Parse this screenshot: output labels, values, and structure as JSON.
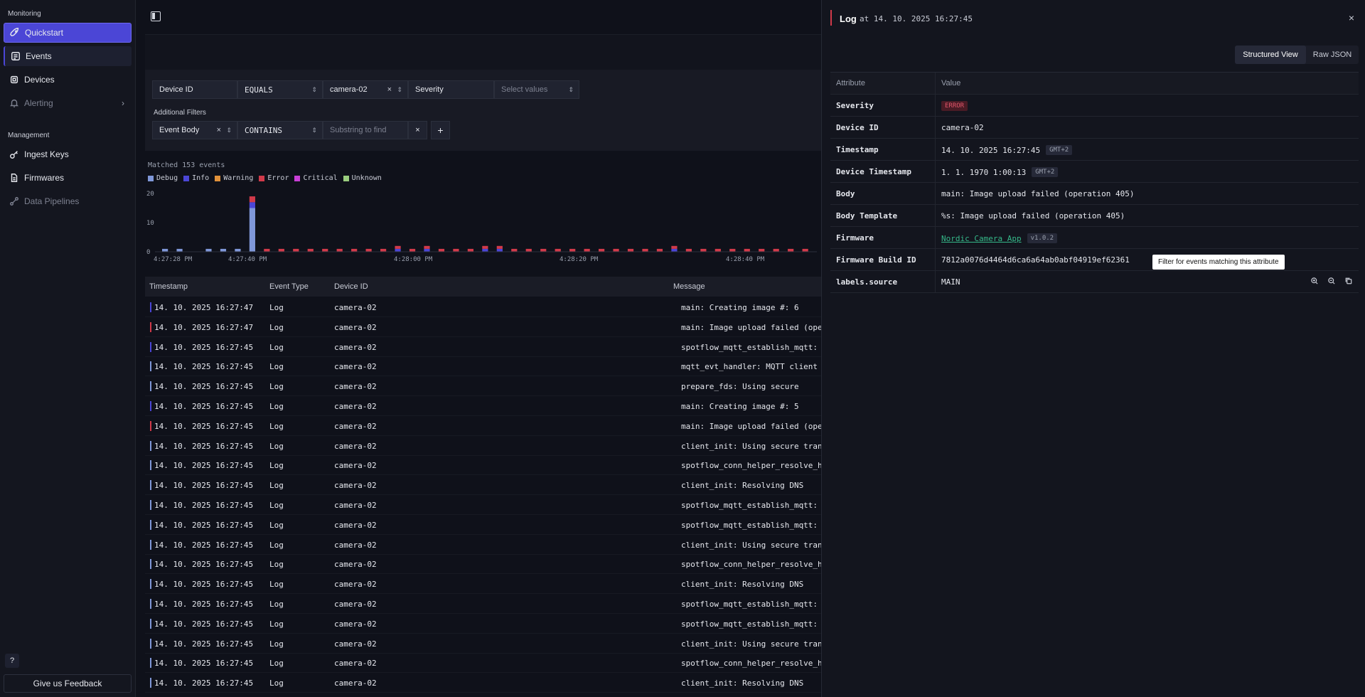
{
  "sidebar": {
    "monitoring_label": "Monitoring",
    "management_label": "Management",
    "items": [
      {
        "label": "Quickstart"
      },
      {
        "label": "Events"
      },
      {
        "label": "Devices"
      },
      {
        "label": "Alerting"
      },
      {
        "label": "Ingest Keys"
      },
      {
        "label": "Firmwares"
      },
      {
        "label": "Data Pipelines"
      }
    ],
    "help": "?",
    "feedback": "Give us Feedback"
  },
  "filters": {
    "field1": "Device ID",
    "op1": "EQUALS",
    "value1": "camera-02",
    "field2": "Severity",
    "value2_placeholder": "Select values",
    "additional_label": "Additional Filters",
    "field3": "Event Body",
    "op3": "CONTAINS",
    "value3_placeholder": "Substring to find",
    "add": "+"
  },
  "summary": {
    "matched": "Matched 153 events"
  },
  "legend": [
    {
      "name": "Debug",
      "color": "#7f97d8"
    },
    {
      "name": "Info",
      "color": "#4b46d6"
    },
    {
      "name": "Warning",
      "color": "#e0913a"
    },
    {
      "name": "Error",
      "color": "#d13a4a"
    },
    {
      "name": "Critical",
      "color": "#c93fd6"
    },
    {
      "name": "Unknown",
      "color": "#9acd7e"
    }
  ],
  "chart_data": {
    "type": "bar",
    "ylim": [
      0,
      20
    ],
    "yticks": [
      "20",
      "10",
      "0"
    ],
    "xticks": [
      "4:27:28 PM",
      "4:27:40 PM",
      "4:28:00 PM",
      "4:28:20 PM",
      "4:28:40 PM"
    ],
    "series": [
      {
        "name": "Debug",
        "values": [
          1,
          1,
          0,
          1,
          1,
          1,
          15,
          0,
          0,
          0,
          0,
          0,
          0,
          0,
          0,
          0,
          0,
          0,
          0,
          0,
          0,
          0,
          0,
          0,
          0,
          0,
          0,
          0,
          0,
          0,
          0,
          0,
          0,
          0,
          0,
          0,
          0,
          0,
          0,
          0,
          0,
          0,
          0,
          0,
          0
        ]
      },
      {
        "name": "Info",
        "values": [
          0,
          0,
          0,
          0,
          0,
          0,
          2,
          0,
          0,
          0,
          0,
          0,
          0,
          0,
          0,
          0,
          1,
          0,
          1,
          0,
          0,
          0,
          1,
          1,
          0,
          0,
          0,
          0,
          0,
          0,
          0,
          0,
          0,
          0,
          0,
          1,
          0,
          0,
          0,
          0,
          0,
          0,
          0,
          0,
          0
        ]
      },
      {
        "name": "Error",
        "values": [
          0,
          0,
          0,
          0,
          0,
          0,
          2,
          1,
          1,
          1,
          1,
          1,
          1,
          1,
          1,
          1,
          1,
          1,
          1,
          1,
          1,
          1,
          1,
          1,
          1,
          1,
          1,
          1,
          1,
          1,
          1,
          1,
          1,
          1,
          1,
          1,
          1,
          1,
          1,
          1,
          1,
          1,
          1,
          1,
          1
        ]
      }
    ]
  },
  "table": {
    "headers": [
      "Timestamp",
      "Event Type",
      "Device ID",
      "Message"
    ],
    "rows": [
      {
        "ts": "14. 10. 2025 16:27:47",
        "type": "Log",
        "dev": "camera-02",
        "msg": "main: Creating image #: 6",
        "sev": "info"
      },
      {
        "ts": "14. 10. 2025 16:27:47",
        "type": "Log",
        "dev": "camera-02",
        "msg": "main: Image upload failed (operat",
        "sev": "error"
      },
      {
        "ts": "14. 10. 2025 16:27:45",
        "type": "Log",
        "dev": "camera-02",
        "msg": "spotflow_mqtt_establish_mqtt: MQT",
        "sev": "info"
      },
      {
        "ts": "14. 10. 2025 16:27:45",
        "type": "Log",
        "dev": "camera-02",
        "msg": "mqtt_evt_handler: MQTT client con",
        "sev": "debug"
      },
      {
        "ts": "14. 10. 2025 16:27:45",
        "type": "Log",
        "dev": "camera-02",
        "msg": "prepare_fds: Using secure",
        "sev": "debug"
      },
      {
        "ts": "14. 10. 2025 16:27:45",
        "type": "Log",
        "dev": "camera-02",
        "msg": "main: Creating image #: 5",
        "sev": "info"
      },
      {
        "ts": "14. 10. 2025 16:27:45",
        "type": "Log",
        "dev": "camera-02",
        "msg": "main: Image upload failed (operat",
        "sev": "error"
      },
      {
        "ts": "14. 10. 2025 16:27:45",
        "type": "Log",
        "dev": "camera-02",
        "msg": "client_init: Using secure transpo",
        "sev": "debug"
      },
      {
        "ts": "14. 10. 2025 16:27:45",
        "type": "Log",
        "dev": "camera-02",
        "msg": "spotflow_conn_helper_resolve_host",
        "sev": "debug"
      },
      {
        "ts": "14. 10. 2025 16:27:45",
        "type": "Log",
        "dev": "camera-02",
        "msg": "client_init: Resolving DNS",
        "sev": "debug"
      },
      {
        "ts": "14. 10. 2025 16:27:45",
        "type": "Log",
        "dev": "camera-02",
        "msg": "spotflow_mqtt_establish_mqtt: mqt",
        "sev": "debug"
      },
      {
        "ts": "14. 10. 2025 16:27:45",
        "type": "Log",
        "dev": "camera-02",
        "msg": "spotflow_mqtt_establish_mqtt: mqt",
        "sev": "debug"
      },
      {
        "ts": "14. 10. 2025 16:27:45",
        "type": "Log",
        "dev": "camera-02",
        "msg": "client_init: Using secure transpo",
        "sev": "debug"
      },
      {
        "ts": "14. 10. 2025 16:27:45",
        "type": "Log",
        "dev": "camera-02",
        "msg": "spotflow_conn_helper_resolve_host",
        "sev": "debug"
      },
      {
        "ts": "14. 10. 2025 16:27:45",
        "type": "Log",
        "dev": "camera-02",
        "msg": "client_init: Resolving DNS",
        "sev": "debug"
      },
      {
        "ts": "14. 10. 2025 16:27:45",
        "type": "Log",
        "dev": "camera-02",
        "msg": "spotflow_mqtt_establish_mqtt: mqt",
        "sev": "debug"
      },
      {
        "ts": "14. 10. 2025 16:27:45",
        "type": "Log",
        "dev": "camera-02",
        "msg": "spotflow_mqtt_establish_mqtt: mqt",
        "sev": "debug"
      },
      {
        "ts": "14. 10. 2025 16:27:45",
        "type": "Log",
        "dev": "camera-02",
        "msg": "client_init: Using secure transpo",
        "sev": "debug"
      },
      {
        "ts": "14. 10. 2025 16:27:45",
        "type": "Log",
        "dev": "camera-02",
        "msg": "spotflow_conn_helper_resolve_host",
        "sev": "debug"
      },
      {
        "ts": "14. 10. 2025 16:27:45",
        "type": "Log",
        "dev": "camera-02",
        "msg": "client_init: Resolving DNS",
        "sev": "debug"
      }
    ]
  },
  "panel": {
    "title": "Log",
    "subtitle": "at 14. 10. 2025 16:27:45",
    "close": "×",
    "view_structured": "Structured View",
    "view_raw": "Raw JSON",
    "col_attr": "Attribute",
    "col_value": "Value",
    "attrs": [
      {
        "k": "Severity",
        "v": "ERROR"
      },
      {
        "k": "Device ID",
        "v": "camera-02"
      },
      {
        "k": "Timestamp",
        "v": "14. 10. 2025 16:27:45",
        "tag": "GMT+2"
      },
      {
        "k": "Device Timestamp",
        "v": "1. 1. 1970 1:00:13",
        "tag": "GMT+2"
      },
      {
        "k": "Body",
        "v": "main: Image upload failed (operation 405)"
      },
      {
        "k": "Body Template",
        "v": "%s: Image upload failed (operation 405)"
      },
      {
        "k": "Firmware",
        "v": "Nordic Camera App",
        "tag": "v1.0.2"
      },
      {
        "k": "Firmware Build ID",
        "v": "7812a0076d4464d6ca6a64ab0abf04919ef62361"
      },
      {
        "k": "labels.source",
        "v": "MAIN"
      }
    ],
    "tooltip": "Filter for events matching this attribute"
  },
  "colors": {
    "accent": "#4b46d6",
    "error": "#d13a4a",
    "info": "#4b46d6",
    "debug": "#7f97d8",
    "link": "#35b889"
  }
}
